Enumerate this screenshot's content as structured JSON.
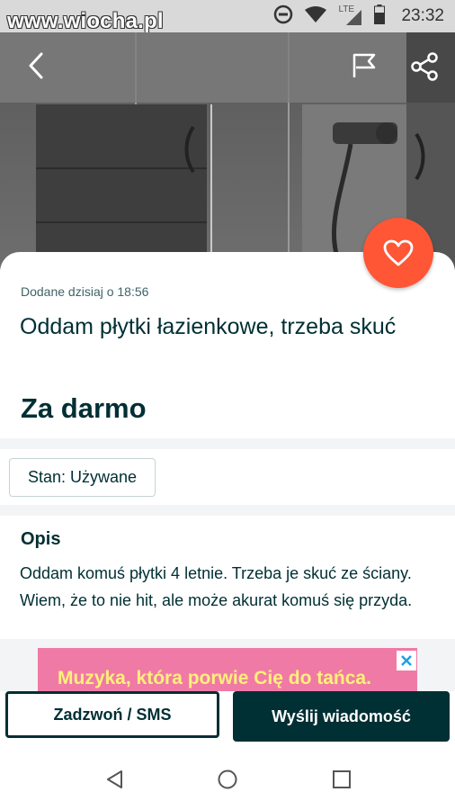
{
  "status_bar": {
    "watermark": "www.wiocha.pl",
    "network_label": "LTE",
    "time": "23:32",
    "icons": [
      "do-not-disturb-icon",
      "wifi-icon",
      "signal-icon",
      "battery-icon"
    ]
  },
  "listing": {
    "added": "Dodane dzisiaj o 18:56",
    "title": "Oddam płytki łazienkowe, trzeba skuć",
    "price": "Za darmo",
    "condition": "Stan: Używane",
    "description_heading": "Opis",
    "description": "Oddam komuś płytki 4 letnie. Trzeba je skuć ze ściany. Wiem, że to nie hit, ale może akurat komuś się przyda."
  },
  "ad": {
    "text": "Muzyka, która porwie Cię do tańca."
  },
  "actions": {
    "call_label": "Zadzwoń / SMS",
    "message_label": "Wyślij wiadomość"
  },
  "colors": {
    "accent_heart": "#ff5636",
    "primary_dark": "#002f34",
    "ad_background": "#f07aa6",
    "ad_text": "#fff07a"
  }
}
